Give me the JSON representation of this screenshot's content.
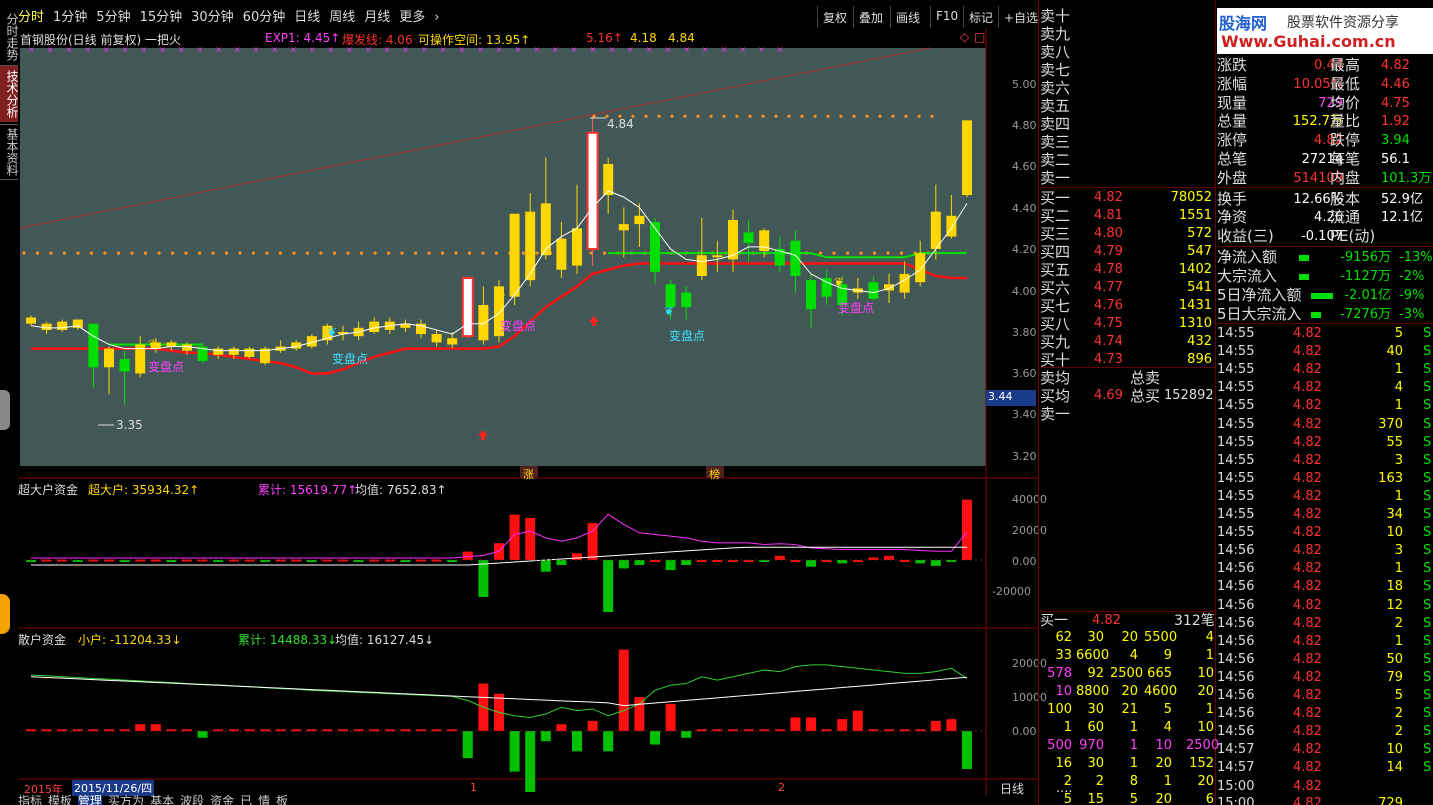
{
  "side_tabs": [
    "分时走势",
    "技术分析",
    "基本资料"
  ],
  "timeframes": [
    "分时",
    "1分钟",
    "5分钟",
    "15分钟",
    "30分钟",
    "60分钟",
    "日线",
    "周线",
    "月线",
    "更多"
  ],
  "toolbar": [
    "复权",
    "叠加",
    "画线",
    "F10",
    "标记",
    "+自选"
  ],
  "logo": {
    "brand": "股海网",
    "slogan": "股票软件资源分享",
    "url": "Www.Guhai.com.cn"
  },
  "legend": {
    "title": "首钢股份(日线 前复权) 一把火",
    "exp1": "EXP1: 4.45↑",
    "bfx": "爆发线: 4.06",
    "kczj": "可操作空间: 13.95↑",
    "v1": "5.16↑",
    "v2": "4.18",
    "v3": "4.84"
  },
  "price_axis": [
    "5.00",
    "4.80",
    "4.60",
    "4.40",
    "4.20",
    "4.00",
    "3.80",
    "3.60",
    "3.40",
    "3.20"
  ],
  "price_tag": "3.44",
  "annotations": {
    "high": "4.84",
    "low": "3.35",
    "turn": "变盘点",
    "zhang": "涨",
    "bang": "榜"
  },
  "fund1": {
    "title": "超大户资金",
    "label": "超大户: 35934.32↑",
    "cum": "累计: 15619.77↑",
    "avg": "均值: 7652.83↑",
    "axis": [
      "40000",
      "20000",
      "0.00",
      "-20000"
    ]
  },
  "fund2": {
    "title": "散户资金",
    "label": "小户: -11204.33↓",
    "cum": "累计: 14488.33↓",
    "avg": "均值: 16127.45↓",
    "axis": [
      "20000",
      "10000",
      "0.00"
    ]
  },
  "date_axis": {
    "year": "2015年",
    "date": "2015/11/26/四",
    "m1": "1",
    "m2": "2",
    "period": "日线"
  },
  "bottom_tabs": [
    "指标",
    "模板",
    "管理",
    "买方为",
    "基本",
    "波段",
    "资金",
    "已",
    "情",
    "板"
  ],
  "sell_levels": [
    "卖十",
    "卖九",
    "卖八",
    "卖七",
    "卖六",
    "卖五",
    "卖四",
    "卖三",
    "卖二",
    "卖一"
  ],
  "buy_levels": [
    {
      "l": "买一",
      "p": "4.82",
      "v": "78052"
    },
    {
      "l": "买二",
      "p": "4.81",
      "v": "1551"
    },
    {
      "l": "买三",
      "p": "4.80",
      "v": "572"
    },
    {
      "l": "买四",
      "p": "4.79",
      "v": "547"
    },
    {
      "l": "买五",
      "p": "4.78",
      "v": "1402"
    },
    {
      "l": "买六",
      "p": "4.77",
      "v": "541"
    },
    {
      "l": "买七",
      "p": "4.76",
      "v": "1431"
    },
    {
      "l": "买八",
      "p": "4.75",
      "v": "1310"
    },
    {
      "l": "买九",
      "p": "4.74",
      "v": "432"
    },
    {
      "l": "买十",
      "p": "4.73",
      "v": "896"
    }
  ],
  "avg": {
    "sell": "卖均",
    "buy": "买均",
    "buyp": "4.69",
    "tsell": "总卖",
    "tbuy": "总买",
    "tbuyv": "152892",
    "s1": "卖一"
  },
  "queue": {
    "label": "买一",
    "price": "4.82",
    "count": "312笔",
    "rows": [
      [
        "62",
        "30",
        "20",
        "5500",
        "4"
      ],
      [
        "33",
        "6600",
        "4",
        "9",
        "1"
      ],
      [
        "578",
        "92",
        "2500",
        "665",
        "10"
      ],
      [
        "10",
        "8800",
        "20",
        "4600",
        "20"
      ],
      [
        "100",
        "30",
        "21",
        "5",
        "1"
      ],
      [
        "1",
        "60",
        "1",
        "4",
        "10"
      ],
      [
        "500",
        "970",
        "1",
        "10",
        "2500"
      ],
      [
        "16",
        "30",
        "1",
        "20",
        "152"
      ],
      [
        "2",
        "2",
        "8",
        "1",
        "20"
      ],
      [
        "5",
        "15",
        "5",
        "20",
        "6"
      ]
    ],
    "more": "...."
  },
  "quote": [
    {
      "a": "涨跌",
      "b": "0.44",
      "c": "最高",
      "d": "4.82"
    },
    {
      "a": "涨幅",
      "b": "10.05%",
      "c": "最低",
      "d": "4.46"
    },
    {
      "a": "现量",
      "b": "729",
      "c": "均价",
      "d": "4.75"
    },
    {
      "a": "总量",
      "b": "152.7万",
      "c": "量比",
      "d": "1.92"
    },
    {
      "a": "涨停",
      "b": "4.82",
      "c": "跌停",
      "d": "3.94"
    },
    {
      "a": "总笔",
      "b": "27214",
      "c": "每笔",
      "d": "56.1"
    },
    {
      "a": "外盘",
      "b": "514109",
      "c": "内盘",
      "d": "101.3万"
    },
    {
      "a": "换手",
      "b": "12.66%",
      "c": "股本",
      "d": "52.9亿"
    },
    {
      "a": "净资",
      "b": "4.26",
      "c": "流通",
      "d": "12.1亿"
    },
    {
      "a": "收益(三)",
      "b": "-0.107",
      "c": "PE(动)",
      "d": ""
    }
  ],
  "flows": [
    {
      "l": "净流入额",
      "v": "-9156万",
      "p": "-13%"
    },
    {
      "l": "大宗流入",
      "v": "-1127万",
      "p": "-2%"
    },
    {
      "l": "5日净流入额",
      "v": "-2.01亿",
      "p": "-9%"
    },
    {
      "l": "5日大宗流入",
      "v": "-7276万",
      "p": "-3%"
    }
  ],
  "ticks": {
    "rows": [
      [
        "14:55",
        "4.82",
        "5",
        "S"
      ],
      [
        "14:55",
        "4.82",
        "40",
        "S"
      ],
      [
        "14:55",
        "4.82",
        "1",
        "S"
      ],
      [
        "14:55",
        "4.82",
        "4",
        "S"
      ],
      [
        "14:55",
        "4.82",
        "1",
        "S"
      ],
      [
        "14:55",
        "4.82",
        "370",
        "S"
      ],
      [
        "14:55",
        "4.82",
        "55",
        "S"
      ],
      [
        "14:55",
        "4.82",
        "3",
        "S"
      ],
      [
        "14:55",
        "4.82",
        "163",
        "S"
      ],
      [
        "14:55",
        "4.82",
        "1",
        "S"
      ],
      [
        "14:55",
        "4.82",
        "34",
        "S"
      ],
      [
        "14:55",
        "4.82",
        "10",
        "S"
      ],
      [
        "14:56",
        "4.82",
        "3",
        "S"
      ],
      [
        "14:56",
        "4.82",
        "1",
        "S"
      ],
      [
        "14:56",
        "4.82",
        "18",
        "S"
      ],
      [
        "14:56",
        "4.82",
        "12",
        "S"
      ],
      [
        "14:56",
        "4.82",
        "2",
        "S"
      ],
      [
        "14:56",
        "4.82",
        "1",
        "S"
      ],
      [
        "14:56",
        "4.82",
        "50",
        "S"
      ],
      [
        "14:56",
        "4.82",
        "79",
        "S"
      ],
      [
        "14:56",
        "4.82",
        "5",
        "S"
      ],
      [
        "14:56",
        "4.82",
        "2",
        "S"
      ],
      [
        "14:56",
        "4.82",
        "2",
        "S"
      ],
      [
        "14:57",
        "4.82",
        "10",
        "S"
      ],
      [
        "14:57",
        "4.82",
        "14",
        "S"
      ],
      [
        "15:00",
        "4.82",
        "",
        ""
      ]
    ],
    "last_t": "15:00",
    "last_p": "4.82",
    "last_v": "729"
  },
  "colors": {
    "up": "#ff3232",
    "down": "#00e000",
    "gold": "#ffd700",
    "bg": "#425856"
  },
  "candles": [
    {
      "o": 3.87,
      "c": 3.84,
      "h": 3.88,
      "l": 3.83,
      "u": 1
    },
    {
      "o": 3.81,
      "c": 3.84,
      "h": 3.85,
      "l": 3.79,
      "u": 1
    },
    {
      "o": 3.81,
      "c": 3.85,
      "h": 3.86,
      "l": 3.8,
      "u": 1
    },
    {
      "o": 3.82,
      "c": 3.86,
      "h": 3.86,
      "l": 3.81,
      "u": 1
    },
    {
      "o": 3.84,
      "c": 3.63,
      "h": 3.84,
      "l": 3.53,
      "u": 0
    },
    {
      "o": 3.63,
      "c": 3.72,
      "h": 3.73,
      "l": 3.5,
      "u": 1
    },
    {
      "o": 3.67,
      "c": 3.61,
      "h": 3.71,
      "l": 3.45,
      "u": 0
    },
    {
      "o": 3.6,
      "c": 3.74,
      "h": 3.78,
      "l": 3.58,
      "u": 1
    },
    {
      "o": 3.72,
      "c": 3.75,
      "h": 3.77,
      "l": 3.7,
      "u": 1
    },
    {
      "o": 3.73,
      "c": 3.75,
      "h": 3.76,
      "l": 3.71,
      "u": 1
    },
    {
      "o": 3.71,
      "c": 3.74,
      "h": 3.75,
      "l": 3.69,
      "u": 1
    },
    {
      "o": 3.73,
      "c": 3.66,
      "h": 3.74,
      "l": 3.65,
      "u": 0
    },
    {
      "o": 3.69,
      "c": 3.72,
      "h": 3.73,
      "l": 3.67,
      "u": 1
    },
    {
      "o": 3.69,
      "c": 3.72,
      "h": 3.73,
      "l": 3.67,
      "u": 1
    },
    {
      "o": 3.68,
      "c": 3.72,
      "h": 3.73,
      "l": 3.67,
      "u": 1
    },
    {
      "o": 3.65,
      "c": 3.72,
      "h": 3.73,
      "l": 3.64,
      "u": 1
    },
    {
      "o": 3.71,
      "c": 3.73,
      "h": 3.76,
      "l": 3.7,
      "u": 1
    },
    {
      "o": 3.72,
      "c": 3.75,
      "h": 3.76,
      "l": 3.71,
      "u": 1
    },
    {
      "o": 3.73,
      "c": 3.78,
      "h": 3.79,
      "l": 3.72,
      "u": 1
    },
    {
      "o": 3.76,
      "c": 3.83,
      "h": 3.84,
      "l": 3.74,
      "u": 1
    },
    {
      "o": 3.8,
      "c": 3.8,
      "h": 3.83,
      "l": 3.76,
      "u": 1
    },
    {
      "o": 3.78,
      "c": 3.82,
      "h": 3.85,
      "l": 3.76,
      "u": 1
    },
    {
      "o": 3.8,
      "c": 3.85,
      "h": 3.87,
      "l": 3.79,
      "u": 1
    },
    {
      "o": 3.81,
      "c": 3.85,
      "h": 3.87,
      "l": 3.79,
      "u": 1
    },
    {
      "o": 3.82,
      "c": 3.84,
      "h": 3.86,
      "l": 3.8,
      "u": 1
    },
    {
      "o": 3.84,
      "c": 3.79,
      "h": 3.86,
      "l": 3.77,
      "u": 1
    },
    {
      "o": 3.75,
      "c": 3.79,
      "h": 3.81,
      "l": 3.73,
      "u": 1
    },
    {
      "o": 3.74,
      "c": 3.77,
      "h": 3.8,
      "l": 3.72,
      "u": 1
    },
    {
      "o": 3.78,
      "c": 4.06,
      "h": 4.07,
      "l": 3.77,
      "u": 1
    },
    {
      "o": 3.93,
      "c": 3.76,
      "h": 4.02,
      "l": 3.74,
      "u": 1
    },
    {
      "o": 3.78,
      "c": 4.02,
      "h": 4.05,
      "l": 3.75,
      "u": 1
    },
    {
      "o": 3.97,
      "c": 4.37,
      "h": 4.37,
      "l": 3.93,
      "u": 1
    },
    {
      "o": 4.05,
      "c": 4.38,
      "h": 4.47,
      "l": 4.02,
      "u": 1
    },
    {
      "o": 4.17,
      "c": 4.42,
      "h": 4.64,
      "l": 4.15,
      "u": 1
    },
    {
      "o": 4.25,
      "c": 4.1,
      "h": 4.33,
      "l": 4.06,
      "u": 1
    },
    {
      "o": 4.12,
      "c": 4.3,
      "h": 4.51,
      "l": 4.08,
      "u": 1
    },
    {
      "o": 4.2,
      "c": 4.76,
      "h": 4.84,
      "l": 4.12,
      "u": 1
    },
    {
      "o": 4.46,
      "c": 4.61,
      "h": 4.64,
      "l": 4.37,
      "u": 1
    },
    {
      "o": 4.29,
      "c": 4.32,
      "h": 4.4,
      "l": 4.16,
      "u": 1
    },
    {
      "o": 4.32,
      "c": 4.36,
      "h": 4.42,
      "l": 4.21,
      "u": 1
    },
    {
      "o": 4.33,
      "c": 4.09,
      "h": 4.35,
      "l": 4.03,
      "u": 0
    },
    {
      "o": 4.03,
      "c": 3.92,
      "h": 4.05,
      "l": 3.86,
      "u": 0
    },
    {
      "o": 3.92,
      "c": 3.99,
      "h": 4.02,
      "l": 3.86,
      "u": 0
    },
    {
      "o": 4.07,
      "c": 4.17,
      "h": 4.35,
      "l": 4.05,
      "u": 1
    },
    {
      "o": 4.16,
      "c": 4.17,
      "h": 4.24,
      "l": 4.09,
      "u": 1
    },
    {
      "o": 4.15,
      "c": 4.34,
      "h": 4.39,
      "l": 4.09,
      "u": 1
    },
    {
      "o": 4.28,
      "c": 4.23,
      "h": 4.34,
      "l": 4.14,
      "u": 0
    },
    {
      "o": 4.29,
      "c": 4.19,
      "h": 4.3,
      "l": 4.16,
      "u": 1
    },
    {
      "o": 4.2,
      "c": 4.12,
      "h": 4.26,
      "l": 4.09,
      "u": 0
    },
    {
      "o": 4.24,
      "c": 4.07,
      "h": 4.29,
      "l": 3.99,
      "u": 0
    },
    {
      "o": 4.05,
      "c": 3.91,
      "h": 4.08,
      "l": 3.82,
      "u": 0
    },
    {
      "o": 4.06,
      "c": 3.97,
      "h": 4.1,
      "l": 3.93,
      "u": 0
    },
    {
      "o": 4.03,
      "c": 3.93,
      "h": 4.07,
      "l": 3.88,
      "u": 0
    },
    {
      "o": 3.99,
      "c": 4.01,
      "h": 4.06,
      "l": 3.96,
      "u": 1
    },
    {
      "o": 4.04,
      "c": 3.96,
      "h": 4.07,
      "l": 3.95,
      "u": 0
    },
    {
      "o": 4.0,
      "c": 4.03,
      "h": 4.08,
      "l": 3.94,
      "u": 1
    },
    {
      "o": 3.99,
      "c": 4.08,
      "h": 4.14,
      "l": 3.96,
      "u": 1
    },
    {
      "o": 4.04,
      "c": 4.18,
      "h": 4.24,
      "l": 4.02,
      "u": 1
    },
    {
      "o": 4.2,
      "c": 4.38,
      "h": 4.51,
      "l": 4.15,
      "u": 1
    },
    {
      "o": 4.26,
      "c": 4.36,
      "h": 4.46,
      "l": 4.25,
      "u": 1
    },
    {
      "o": 4.46,
      "c": 4.82,
      "h": 4.82,
      "l": 4.45,
      "u": 1
    }
  ],
  "big_fund": [
    0,
    0,
    0,
    0,
    0,
    0,
    0,
    0,
    0,
    0,
    0,
    0,
    0,
    0,
    0,
    0,
    0,
    0,
    0,
    0,
    0,
    0,
    0,
    0,
    0,
    0,
    0,
    0,
    5000,
    -22000,
    10000,
    27000,
    25000,
    -7000,
    -3000,
    4000,
    22000,
    -31000,
    -5000,
    -3000,
    0,
    -6000,
    -3000,
    0,
    0,
    0,
    0,
    -1000,
    2500,
    0,
    -4000,
    0,
    -2000,
    0,
    1500,
    2500,
    0,
    -2000,
    -3500,
    -1000,
    35934
  ]
}
